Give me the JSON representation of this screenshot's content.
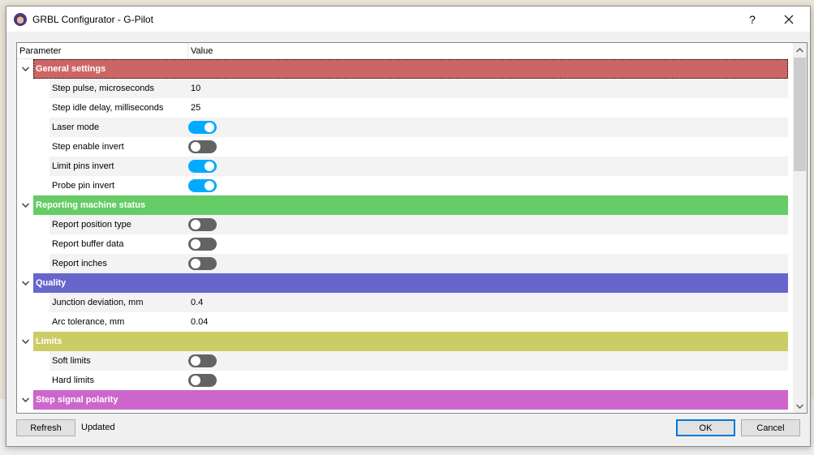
{
  "window": {
    "title": "GRBL Configurator - G-Pilot",
    "help_label": "?",
    "close_icon": "close-icon",
    "app_icon": "avatar-app-icon"
  },
  "tree": {
    "columns": {
      "parameter": "Parameter",
      "value": "Value"
    },
    "categories": [
      {
        "name": "General settings",
        "color": "#cc6666",
        "expanded": true,
        "selected": true,
        "items": [
          {
            "label": "Step pulse, microseconds",
            "type": "text",
            "value": "10"
          },
          {
            "label": "Step idle delay, milliseconds",
            "type": "text",
            "value": "25"
          },
          {
            "label": "Laser mode",
            "type": "toggle",
            "value": true
          },
          {
            "label": "Step enable invert",
            "type": "toggle",
            "value": false
          },
          {
            "label": "Limit pins invert",
            "type": "toggle",
            "value": true
          },
          {
            "label": "Probe pin invert",
            "type": "toggle",
            "value": true
          }
        ]
      },
      {
        "name": "Reporting machine status",
        "color": "#66cc66",
        "expanded": true,
        "selected": false,
        "items": [
          {
            "label": "Report position type",
            "type": "toggle",
            "value": false
          },
          {
            "label": "Report buffer data",
            "type": "toggle",
            "value": false
          },
          {
            "label": "Report inches",
            "type": "toggle",
            "value": false
          }
        ]
      },
      {
        "name": "Quality",
        "color": "#6666cc",
        "expanded": true,
        "selected": false,
        "items": [
          {
            "label": "Junction deviation, mm",
            "type": "text",
            "value": "0.4"
          },
          {
            "label": "Arc tolerance, mm",
            "type": "text",
            "value": "0.04"
          }
        ]
      },
      {
        "name": "Limits",
        "color": "#cccc66",
        "expanded": true,
        "selected": false,
        "items": [
          {
            "label": "Soft limits",
            "type": "toggle",
            "value": false
          },
          {
            "label": "Hard limits",
            "type": "toggle",
            "value": false
          }
        ]
      },
      {
        "name": "Step signal polarity",
        "color": "#cc66cc",
        "expanded": true,
        "selected": false,
        "items": []
      }
    ],
    "toggle_colors": {
      "on": "#00aaff",
      "off": "#636363"
    }
  },
  "footer": {
    "refresh_label": "Refresh",
    "status": "Updated",
    "ok_label": "OK",
    "cancel_label": "Cancel"
  }
}
